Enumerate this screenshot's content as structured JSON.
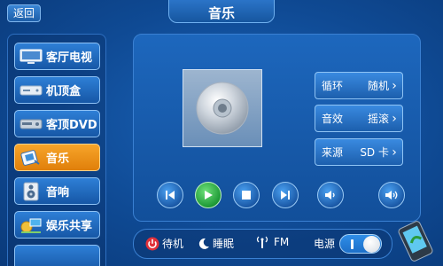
{
  "header": {
    "back_label": "返回",
    "title": "音乐"
  },
  "sidebar": {
    "items": [
      {
        "label": "客厅电视",
        "icon": "tv-icon",
        "active": false
      },
      {
        "label": "机顶盒",
        "icon": "set-top-box-icon",
        "active": false
      },
      {
        "label": "客顶DVD",
        "icon": "dvd-player-icon",
        "active": false
      },
      {
        "label": "音乐",
        "icon": "music-icon",
        "active": true
      },
      {
        "label": "音响",
        "icon": "speaker-icon",
        "active": false
      },
      {
        "label": "娱乐共享",
        "icon": "share-icon",
        "active": false
      }
    ]
  },
  "options": [
    {
      "key": "循环",
      "value": "随机"
    },
    {
      "key": "音效",
      "value": "摇滚"
    },
    {
      "key": "来源",
      "value": "SD 卡"
    }
  ],
  "controls": [
    "previous-icon",
    "play-icon",
    "stop-icon",
    "next-icon",
    "volume-down-icon",
    "volume-up-icon"
  ],
  "bottom": {
    "standby_label": "待机",
    "sleep_label": "睡眠",
    "fm_label": "FM",
    "power_label": "电源",
    "power_on": true
  },
  "colors": {
    "active": "#f29419",
    "accent": "#1d67bd",
    "play": "#1e9a36",
    "standby": "#e0303a"
  }
}
